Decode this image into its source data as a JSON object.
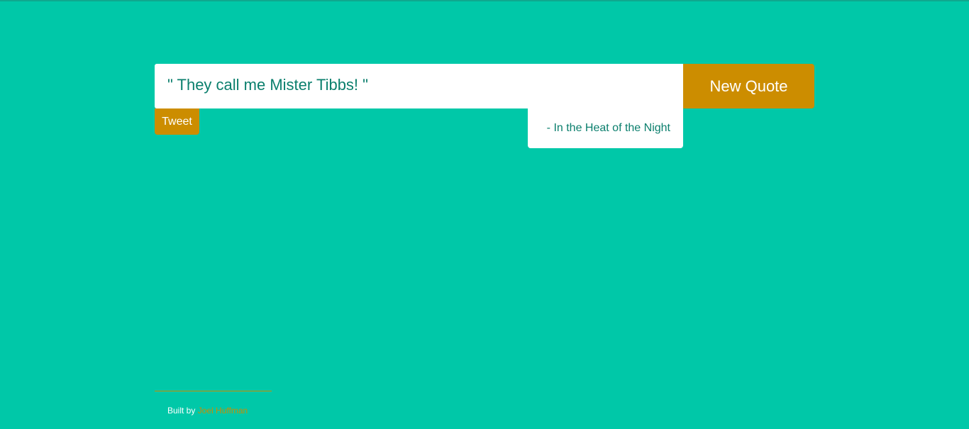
{
  "quote": {
    "text": "\" They call me Mister Tibbs! \"",
    "author": "- In the Heat of the Night"
  },
  "buttons": {
    "new_quote_label": "New Quote",
    "tweet_label": "Tweet"
  },
  "footer": {
    "built_by_label": "Built by",
    "author_name": "Joel Huffman"
  },
  "colors": {
    "background": "#00c8a8",
    "accent": "#cc8d00",
    "text": "#0b7f6d",
    "card": "#ffffff"
  }
}
